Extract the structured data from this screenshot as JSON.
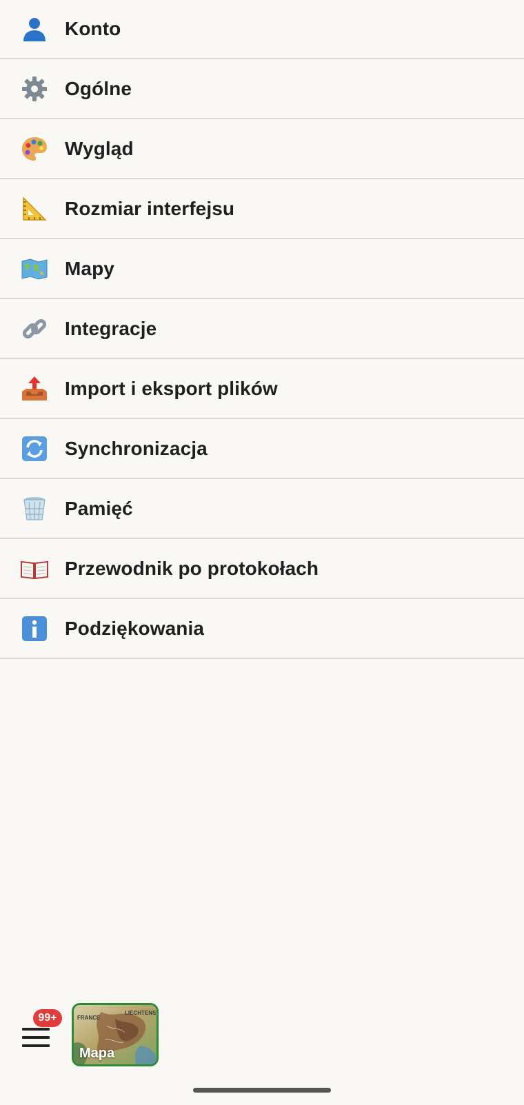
{
  "menu": {
    "items": [
      {
        "label": "Konto",
        "icon": "user-icon"
      },
      {
        "label": "Ogólne",
        "icon": "gear-icon"
      },
      {
        "label": "Wygląd",
        "icon": "palette-icon"
      },
      {
        "label": "Rozmiar interfejsu",
        "icon": "ruler-triangle-icon"
      },
      {
        "label": "Mapy",
        "icon": "world-map-icon"
      },
      {
        "label": "Integracje",
        "icon": "link-icon"
      },
      {
        "label": "Import i eksport plików",
        "icon": "outbox-tray-icon"
      },
      {
        "label": "Synchronizacja",
        "icon": "sync-arrows-icon"
      },
      {
        "label": "Pamięć",
        "icon": "wastebasket-icon"
      },
      {
        "label": "Przewodnik po protokołach",
        "icon": "open-book-icon"
      },
      {
        "label": "Podziękowania",
        "icon": "info-icon"
      }
    ]
  },
  "bottom_bar": {
    "badge": "99+",
    "map_label": "Mapa",
    "map_region_labels": [
      "FRANCE",
      "LIECHTENST"
    ]
  }
}
